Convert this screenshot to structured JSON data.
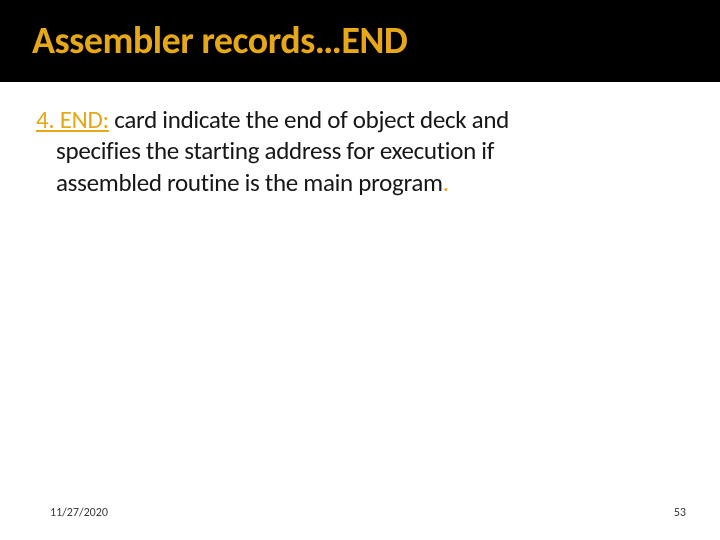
{
  "title": "Assembler records…END",
  "body": {
    "lead": "4. END:",
    "line1_rest": " card indicate the end of object deck and",
    "line2": "specifies the starting address for execution if",
    "line3": "assembled routine is the main program",
    "period": "."
  },
  "footer": {
    "date": "11/27/2020",
    "page": "53"
  }
}
